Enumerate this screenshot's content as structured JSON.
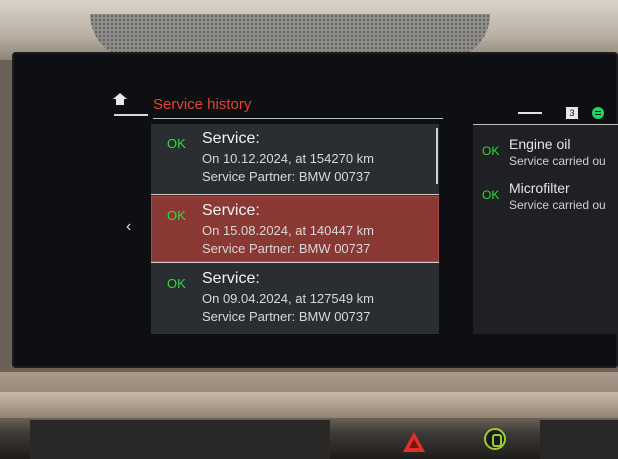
{
  "header": {
    "title": "Service history"
  },
  "service_list": [
    {
      "status": "OK",
      "heading": "Service:",
      "date_line": "On 10.12.2024, at 154270 km",
      "partner_line": "Service Partner: BMW 00737"
    },
    {
      "status": "OK",
      "heading": "Service:",
      "date_line": "On 15.08.2024, at 140447 km",
      "partner_line": "Service Partner: BMW 00737"
    },
    {
      "status": "OK",
      "heading": "Service:",
      "date_line": "On 09.04.2024, at 127549 km",
      "partner_line": "Service Partner: BMW 00737"
    }
  ],
  "status_bar": {
    "badge": "3"
  },
  "right_panel": [
    {
      "status": "OK",
      "title": "Engine oil",
      "subtitle": "Service carried ou"
    },
    {
      "status": "OK",
      "title": "Microfilter",
      "subtitle": "Service carried ou"
    }
  ],
  "icons": {
    "home": "home-icon",
    "back": "chevron-left-icon",
    "media": "spotify-icon",
    "hazard": "hazard-warning-icon"
  },
  "colors": {
    "accent_red": "#e8402c",
    "ok_green": "#2fdb3b",
    "selected_row": "#8a3833"
  },
  "glyphs": {
    "back": "‹"
  }
}
